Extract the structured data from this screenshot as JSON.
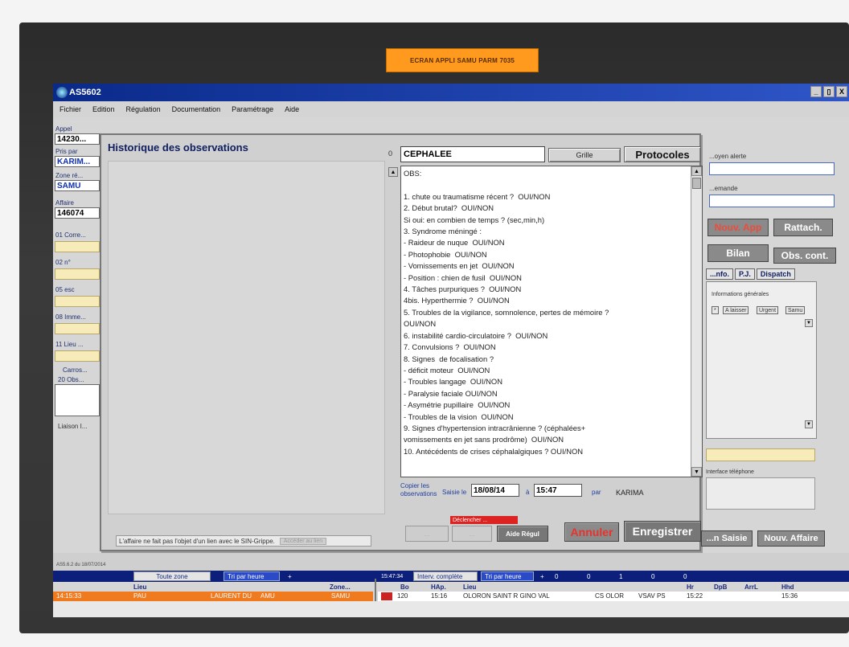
{
  "sticker": "ECRAN APPLI SAMU PARM 7035",
  "window": {
    "title": "AS5602",
    "controls": [
      "_",
      "▯",
      "X"
    ]
  },
  "menu": [
    "Fichier",
    "Edition",
    "Régulation",
    "Documentation",
    "Paramétrage",
    "Aide"
  ],
  "left_fields": {
    "appel_label": "Appel",
    "appel_value": "14230...",
    "pris_par_label": "Pris par",
    "pris_par_value": "KARIM...",
    "zone_label": "Zone ré...",
    "zone_value": "SAMU",
    "affaire_label": "Affaire",
    "affaire_value": "146074",
    "f01": "01 Corre...",
    "f02": "02 n°",
    "f05": "05 esc",
    "f08": "08 Imme...",
    "f11": "11 Lieu ...",
    "carros": "Carros...",
    "f20": "20 Obs...",
    "liaison": "Liaison I..."
  },
  "dialog": {
    "title": "Historique des observations",
    "counter": "0",
    "motif": "CEPHALEE",
    "grille_button": "Grille",
    "protocoles_button": "Protocoles",
    "obs_lines": [
      "OBS:",
      "",
      "1. chute ou traumatisme récent ?  OUI/NON",
      "2. Début brutal?  OUI/NON",
      "Si oui: en combien de temps ? (sec,min,h)",
      "3. Syndrome méningé :",
      "- Raideur de nuque  OUI/NON",
      "- Photophobie  OUI/NON",
      "- Vomissements en jet  OUI/NON",
      "- Position : chien de fusil  OUI/NON",
      "4. Tâches purpuriques ?  OUI/NON",
      "4bis. Hyperthermie ?  OUI/NON",
      "5. Troubles de la vigilance, somnolence, pertes de mémoire ?",
      "OUI/NON",
      "6. instabilité cardio-circulatoire ?  OUI/NON",
      "7. Convulsions ?  OUI/NON",
      "8. Signes  de focalisation ?",
      "- déficit moteur  OUI/NON",
      "- Troubles langage  OUI/NON",
      "- Paralysie faciale OUI/NON",
      "- Asymétrie pupillaire  OUI/NON",
      "- Troubles de la vision  OUI/NON",
      "9. Signes d'hypertension intracrânienne ? (céphalées+",
      "vomissements en jet sans prodrôme)  OUI/NON",
      "10. Antécédents de crises céphalalgiques ? OUI/NON"
    ],
    "copier_label": "Copier les observations",
    "saisie_label": "Saisie le",
    "saisie_date": "18/08/14",
    "a_label": "à",
    "saisie_time": "15:47",
    "par_label": "par",
    "par_value": "KARIMA",
    "declencher_label": "Déclencher ...",
    "ghost_btn_1": "...",
    "ghost_btn_2": "...",
    "aide_regul_button": "Aide Régul",
    "annuler_button": "Annuler",
    "enregistrer_button": "Enregistrer",
    "footer_note": "L'affaire ne fait pas l'objet d'un lien avec le SIN-Grippe.",
    "footer_ghost": "Accéder au lien"
  },
  "right_panel": {
    "moyen_alerte_label": "...oyen alerte",
    "demande_label": "...emande",
    "nouv_app_button": "Nouv. App",
    "rattach_button": "Rattach.",
    "bilan_button": "Bilan",
    "obs_cont_button": "Obs. cont.",
    "tabs": [
      "...nfo.",
      "P.J.",
      "Dispatch"
    ],
    "info_title": "Informations générales",
    "mini_buttons": [
      "*",
      "A laisser",
      "Urgent",
      "Samu"
    ],
    "interface_label": "Interface téléphone",
    "saisie_button": "...n Saisie",
    "nouv_affaire_button": "Nouv. Affaire"
  },
  "bottom": {
    "left_caption": "AS5.6.2 du 18/07/2014",
    "toute_zone": "Toute zone",
    "tri_heure_1": "Tri par heure",
    "plus_1": "+",
    "time_stamp": "15:47:34",
    "interv": "Interv. complète",
    "tri_heure_2": "Tri par heure",
    "plus_2": "+",
    "counters": [
      "0",
      "0",
      "1",
      "0",
      "0"
    ],
    "left_headers": [
      "Lieu",
      "Zone..."
    ],
    "right_headers": [
      "Bo",
      "HAp.",
      "Lieu",
      "Hr",
      "DpB",
      "ArrL",
      "Hhd"
    ],
    "left_row": [
      "14:15:33",
      "PAU",
      "LAURENT DU",
      "AMU",
      "SAMU"
    ],
    "right_row": [
      "120",
      "15:16",
      "OLORON SAINT R GINO VAL",
      "CS OLOR",
      "VSAV PS",
      "15:22",
      "15:36"
    ]
  }
}
